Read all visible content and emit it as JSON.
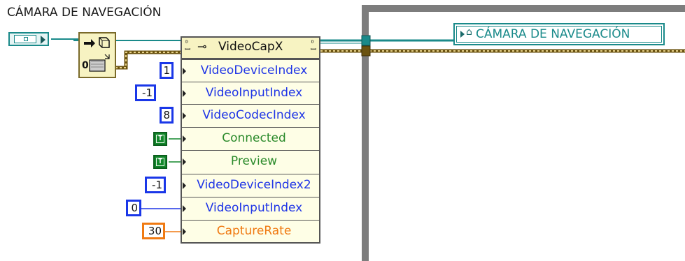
{
  "control": {
    "label": "CÁMARA DE NAVEGACIÓN"
  },
  "to_variant": {
    "name": "to-variant-node"
  },
  "property_node": {
    "class_name": "VideoCapX",
    "properties": [
      {
        "name": "VideoDeviceIndex",
        "value": "1",
        "kind": "numeric"
      },
      {
        "name": "VideoInputIndex",
        "value": "-1",
        "kind": "numeric"
      },
      {
        "name": "VideoCodecIndex",
        "value": "8",
        "kind": "numeric"
      },
      {
        "name": "Connected",
        "value": "T",
        "kind": "boolean"
      },
      {
        "name": "Preview",
        "value": "T",
        "kind": "boolean"
      },
      {
        "name": "VideoDeviceIndex2",
        "value": "-1",
        "kind": "numeric"
      },
      {
        "name": "VideoInputIndex",
        "value": "0",
        "kind": "numeric"
      },
      {
        "name": "CaptureRate",
        "value": "30",
        "kind": "integer"
      }
    ]
  },
  "local_variable": {
    "label": "CÁMARA DE NAVEGACIÓN"
  },
  "colors": {
    "refnum_wire": "#1a8a8a",
    "numeric_blue": "#1f35e6",
    "boolean_green": "#12872b",
    "integer_orange": "#f07a12",
    "variant_wire": "#7a5a1a",
    "structure_gray": "#808080"
  }
}
